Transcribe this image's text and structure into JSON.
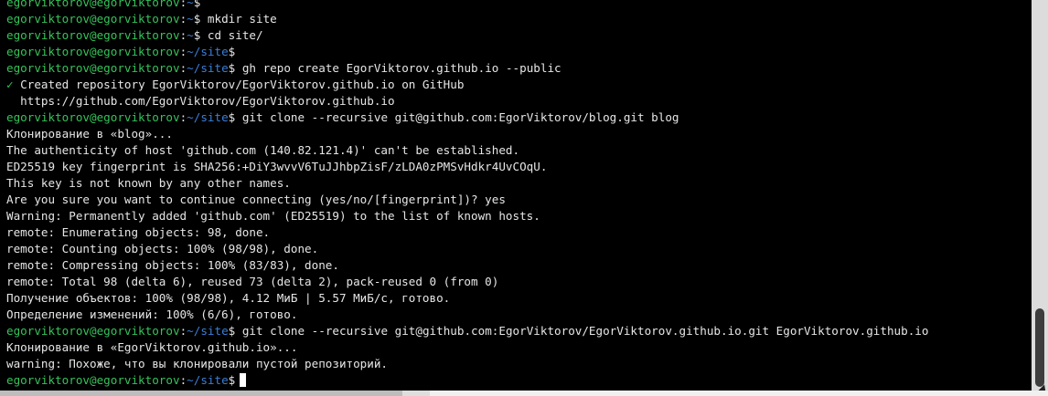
{
  "prompt": {
    "user": "egorviktorov@egorviktorov",
    "separator": ":",
    "home": "~",
    "site": "~/site",
    "symbol": "$"
  },
  "lines": [
    {
      "type": "prompt",
      "path": "~",
      "cmd": ""
    },
    {
      "type": "prompt",
      "path": "~",
      "cmd": " mkdir site"
    },
    {
      "type": "prompt",
      "path": "~",
      "cmd": " cd site/"
    },
    {
      "type": "prompt",
      "path": "~/site",
      "cmd": ""
    },
    {
      "type": "prompt",
      "path": "~/site",
      "cmd": " gh repo create EgorViktorov.github.io --public"
    },
    {
      "type": "check",
      "mark": "✓",
      "text": " Created repository EgorViktorov/EgorViktorov.github.io on GitHub"
    },
    {
      "type": "out",
      "text": "  https://github.com/EgorViktorov/EgorViktorov.github.io"
    },
    {
      "type": "prompt",
      "path": "~/site",
      "cmd": " git clone --recursive git@github.com:EgorViktorov/blog.git blog"
    },
    {
      "type": "out",
      "text": "Клонирование в «blog»..."
    },
    {
      "type": "out",
      "text": "The authenticity of host 'github.com (140.82.121.4)' can't be established."
    },
    {
      "type": "out",
      "text": "ED25519 key fingerprint is SHA256:+DiY3wvvV6TuJJhbpZisF/zLDA0zPMSvHdkr4UvCOqU."
    },
    {
      "type": "out",
      "text": "This key is not known by any other names."
    },
    {
      "type": "out",
      "text": "Are you sure you want to continue connecting (yes/no/[fingerprint])? yes"
    },
    {
      "type": "out",
      "text": "Warning: Permanently added 'github.com' (ED25519) to the list of known hosts."
    },
    {
      "type": "out",
      "text": "remote: Enumerating objects: 98, done."
    },
    {
      "type": "out",
      "text": "remote: Counting objects: 100% (98/98), done."
    },
    {
      "type": "out",
      "text": "remote: Compressing objects: 100% (83/83), done."
    },
    {
      "type": "out",
      "text": "remote: Total 98 (delta 6), reused 73 (delta 2), pack-reused 0 (from 0)"
    },
    {
      "type": "out",
      "text": "Получение объектов: 100% (98/98), 4.12 МиБ | 5.57 МиБ/с, готово."
    },
    {
      "type": "out",
      "text": "Определение изменений: 100% (6/6), готово."
    },
    {
      "type": "prompt",
      "path": "~/site",
      "cmd": " git clone --recursive git@github.com:EgorViktorov/EgorViktorov.github.io.git EgorViktorov.github.io"
    },
    {
      "type": "out",
      "text": "Клонирование в «EgorViktorov.github.io»..."
    },
    {
      "type": "out",
      "text": "warning: Похоже, что вы клонировали пустой репозиторий."
    },
    {
      "type": "prompt",
      "path": "~/site",
      "cmd": "",
      "cursor": true
    }
  ],
  "colors": {
    "background": "#000000",
    "text": "#e6e6e6",
    "user": "#35c35a",
    "path": "#3a7fd8"
  }
}
